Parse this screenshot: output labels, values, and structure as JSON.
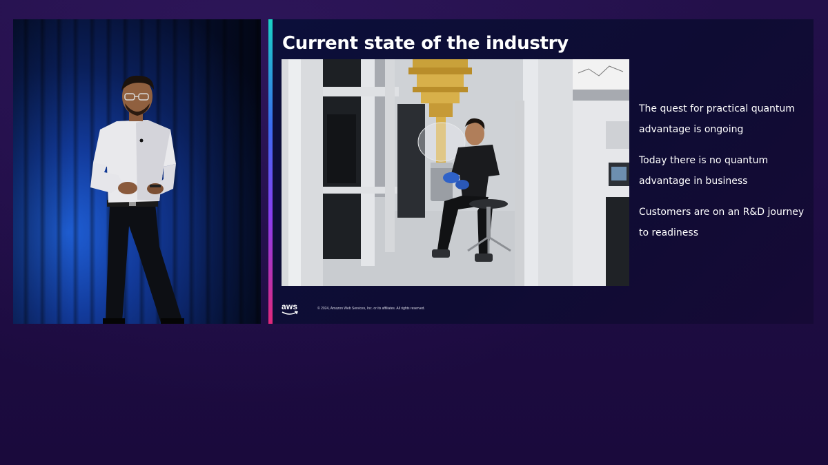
{
  "slide": {
    "title": "Current state of the industry",
    "bullets": [
      "The quest for practical quantum advantage is ongoing",
      "Today there is no quantum advantage in business",
      "Customers are on an R&D journey to readiness"
    ],
    "footer": {
      "logo_text": "aws",
      "copyright": "© 2024, Amazon Web Services, Inc. or its affiliates. All rights reserved."
    }
  },
  "colors": {
    "background": "#1f0d44",
    "slide_background": "#0c0f3a",
    "accent_top": "#19d3c5",
    "accent_bottom": "#e0287a",
    "text": "#ffffff"
  },
  "icons": {
    "logo": "aws-smile-icon"
  }
}
